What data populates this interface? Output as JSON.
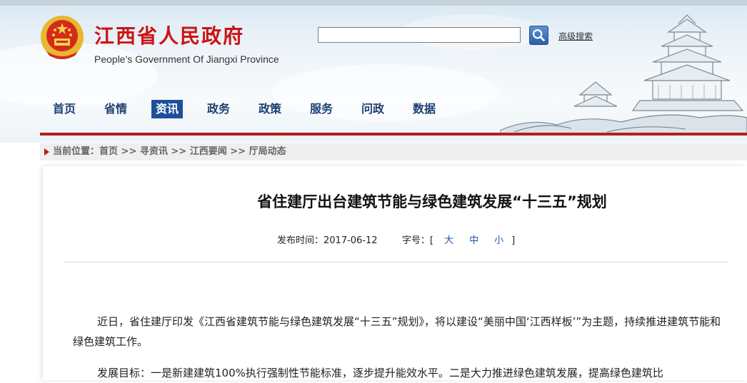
{
  "header": {
    "title": "江西省人民政府",
    "subtitle": "People's Government Of Jiangxi Province",
    "search_placeholder": "",
    "advanced_search": "高级搜索"
  },
  "nav": {
    "items": [
      {
        "label": "首页"
      },
      {
        "label": "省情"
      },
      {
        "label": "资讯",
        "active": true
      },
      {
        "label": "政务"
      },
      {
        "label": "政策"
      },
      {
        "label": "服务"
      },
      {
        "label": "问政"
      },
      {
        "label": "数据"
      }
    ]
  },
  "breadcrumb": {
    "prefix": "当前位置：",
    "sep": " >> ",
    "items": [
      "首页",
      "寻资讯",
      "江西要闻",
      "厅局动态"
    ]
  },
  "article": {
    "title": "省住建厅出台建筑节能与绿色建筑发展“十三五”规划",
    "publish_label": "发布时间：",
    "publish_date": "2017-06-12",
    "font_size_label": "字号：",
    "font_sizes": [
      "大",
      "中",
      "小"
    ],
    "paragraphs": [
      "近日，省住建厅印发《江西省建筑节能与绿色建筑发展“十三五”规划》，将以建设“美丽中国‘江西样板’”为主题，持续推进建筑节能和绿色建筑工作。",
      "发展目标：一是新建建筑100%执行强制性节能标准，逐步提升能效水平。二是大力推进绿色建筑发展，提高绿色建筑比"
    ]
  },
  "colors": {
    "title_red": "#cc1414",
    "nav_blue": "#1d3f72",
    "nav_active_bg": "#1e4f9a",
    "accent_red_line": "#b71c1c",
    "link_blue": "#1d57a8"
  },
  "icons": {
    "emblem": "national-emblem-icon",
    "search": "search-icon",
    "breadcrumb_marker": "triangle-right-icon"
  }
}
